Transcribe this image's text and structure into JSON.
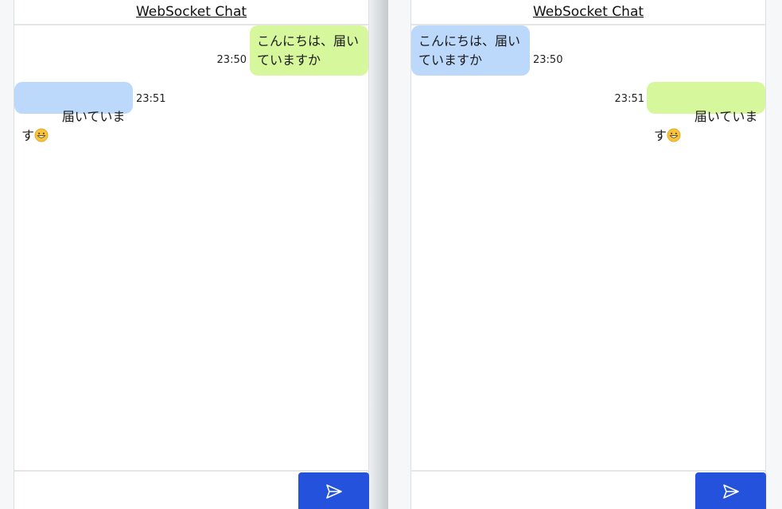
{
  "panes": [
    {
      "title": "WebSocket Chat",
      "messages": [
        {
          "direction": "sent",
          "text": "こんにちは、届い\nていますか",
          "time": "23:50"
        },
        {
          "direction": "received",
          "text": "届いています",
          "emoji": "grinning-face",
          "time": "23:51"
        }
      ],
      "input_value": "",
      "send_icon": "send-icon"
    },
    {
      "title": "WebSocket Chat",
      "messages": [
        {
          "direction": "received",
          "text": "こんにちは、届い\nていますか",
          "time": "23:50"
        },
        {
          "direction": "sent",
          "text": "届いています",
          "emoji": "grinning-face",
          "time": "23:51"
        }
      ],
      "input_value": "",
      "send_icon": "send-icon"
    }
  ],
  "colors": {
    "sent_bubble": "#d7f79c",
    "received_bubble": "#bcd9fb",
    "send_button": "#2452dc"
  }
}
